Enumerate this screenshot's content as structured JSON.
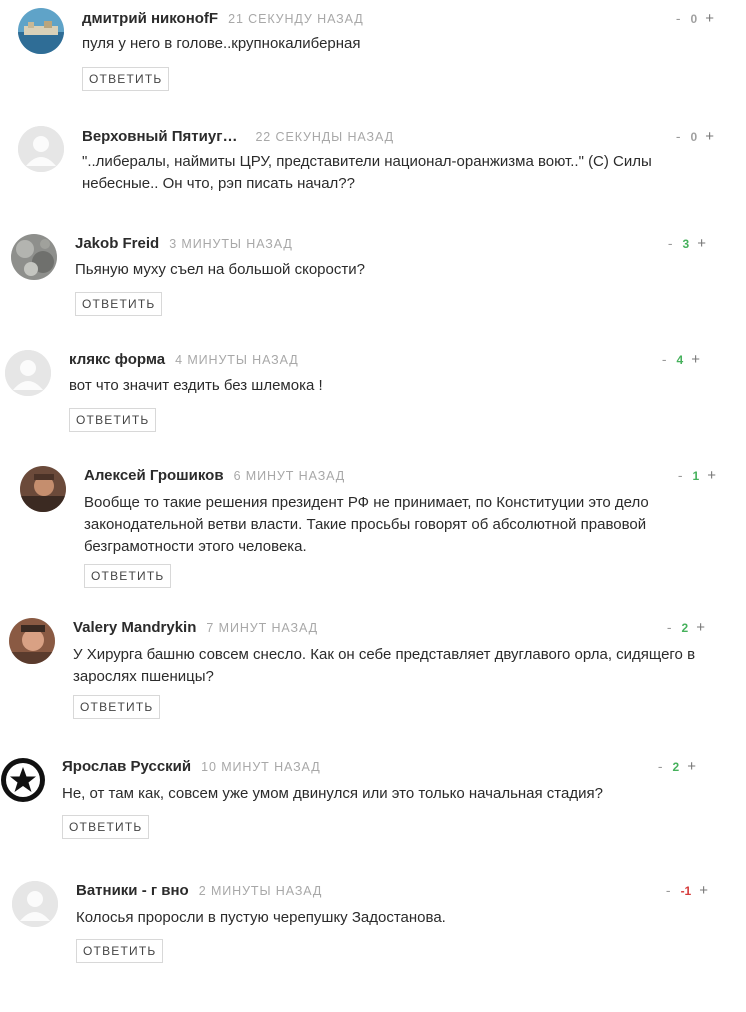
{
  "reply_label": "ОТВЕТИТЬ",
  "comments": [
    {
      "author": "дмитрий никонofF",
      "time": "21 СЕКУНДУ НАЗАД",
      "minus": "-",
      "score": "0",
      "plus": "+",
      "text": "пуля у него в голове..крупнокалиберная",
      "has_reply": true
    },
    {
      "author": "Верховный Пятиуг…",
      "time": "22 СЕКУНДЫ НАЗАД",
      "minus": "-",
      "score": "0",
      "plus": "+",
      "text": "\"..либералы, наймиты ЦРУ, представители национал-оранжизма воют..\" (С) Силы небесные.. Он что, рэп писать начал??",
      "has_reply": false
    },
    {
      "author": "Jakob Freid",
      "time": "3 МИНУТЫ НАЗАД",
      "minus": "-",
      "score": "3",
      "plus": "+",
      "text": "Пьяную муху съел на большой скорости?",
      "has_reply": true
    },
    {
      "author": "клякс форма",
      "time": "4 МИНУТЫ НАЗАД",
      "minus": "-",
      "score": "4",
      "plus": "+",
      "text": "вот что значит ездить без шлемока !",
      "has_reply": true
    },
    {
      "author": "Алексей Грошиков",
      "time": "6 МИНУТ НАЗАД",
      "minus": "-",
      "score": "1",
      "plus": "+",
      "text": "Вообще то такие решения президент РФ не принимает, по Конституции это дело законодательной ветви власти. Такие просьбы говорят об абсолютной правовой безграмотности этого человека.",
      "has_reply": true
    },
    {
      "author": "Valery Mandrykin",
      "time": "7 МИНУТ НАЗАД",
      "minus": "-",
      "score": "2",
      "plus": "+",
      "text": "У Хирурга башню совсем снесло. Как он себе представляет двуглавого орла, сидящего в зарослях пшеницы?",
      "has_reply": true
    },
    {
      "author": "Ярослав Русский",
      "time": "10 МИНУТ НАЗАД",
      "minus": "-",
      "score": "2",
      "plus": "+",
      "text": "Не, от там как, совсем уже умом двинулся или это только начальная стадия?",
      "has_reply": true
    },
    {
      "author": "Ватники - г  вно",
      "time": "2 МИНУТЫ НАЗАД",
      "minus": "-",
      "score": "-1",
      "plus": "+",
      "text": "Колосья проросли в пустую черепушку Задостанова.",
      "has_reply": true
    }
  ]
}
